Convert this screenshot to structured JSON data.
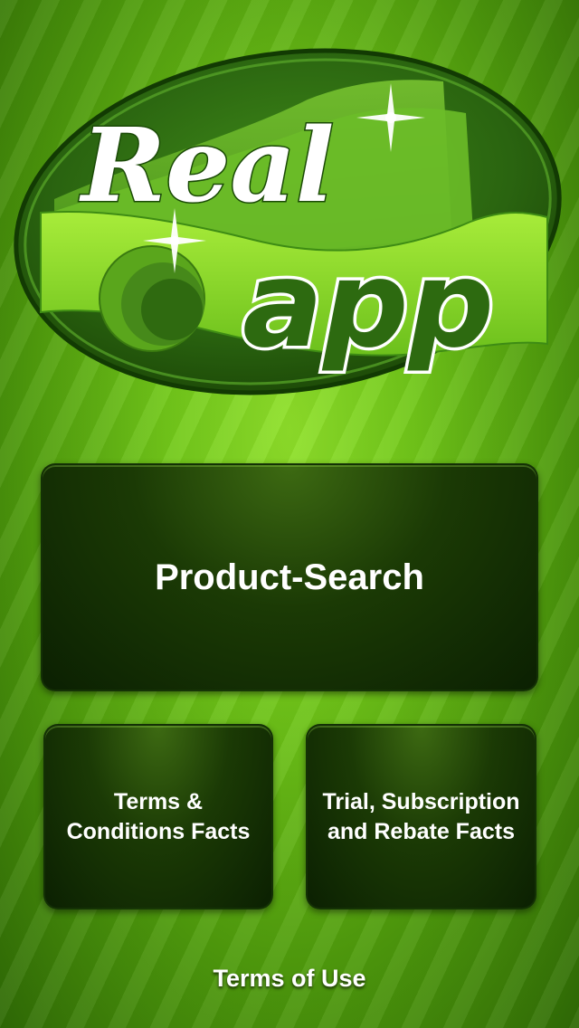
{
  "logo": {
    "word_real": "Real",
    "word_app": "app"
  },
  "buttons": {
    "product_search": "Product-Search",
    "terms_conditions": "Terms & Conditions Facts",
    "trial_subscription": "Trial, Subscription and Rebate Facts"
  },
  "footer": {
    "terms_of_use": "Terms of Use"
  },
  "colors": {
    "background_light": "#8fe02a",
    "background_dark": "#2f6a05",
    "button_dark": "#0b2002",
    "logo_green": "#2d6a10",
    "ribbon_green": "#8ed82a"
  }
}
